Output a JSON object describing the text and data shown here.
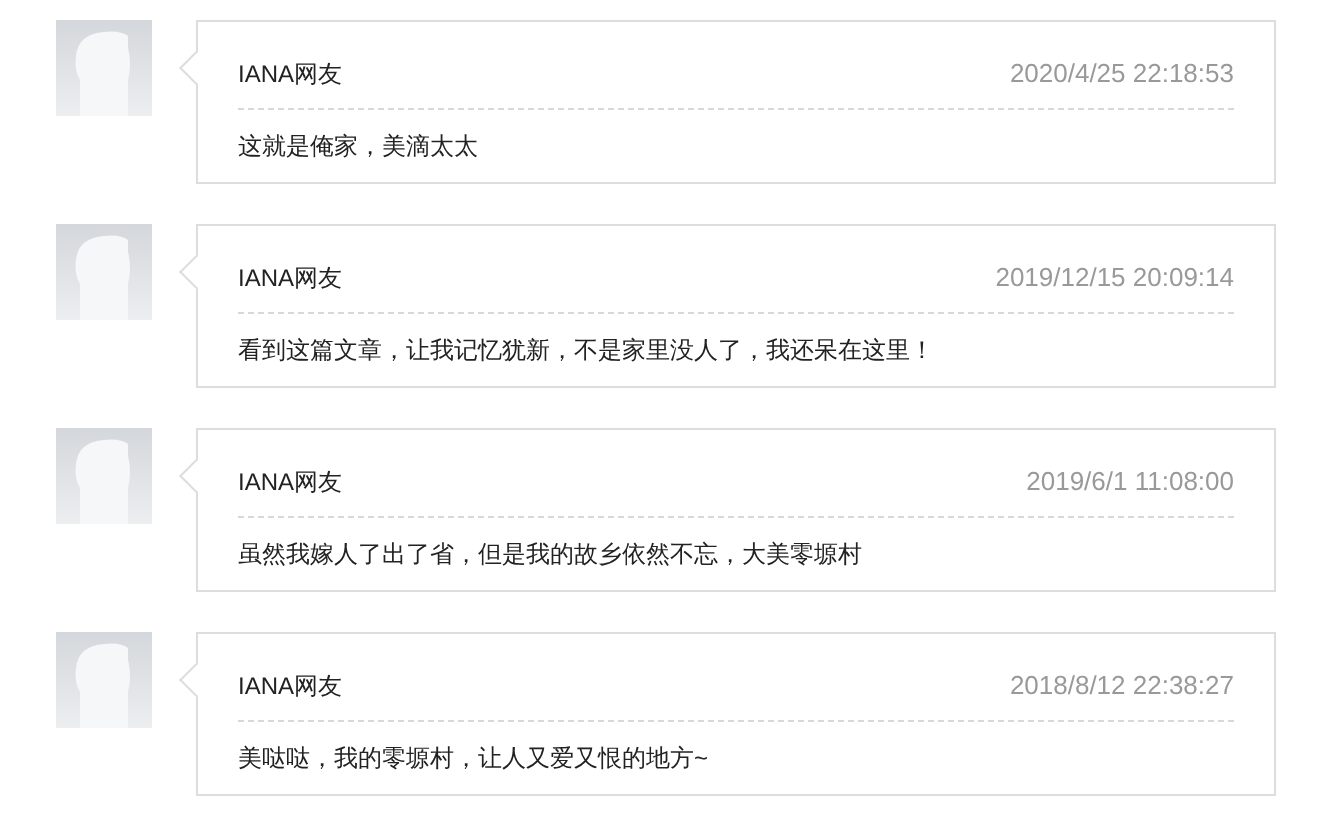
{
  "comments": [
    {
      "user": "IANA网友",
      "time": "2020/4/25 22:18:53",
      "text": "这就是俺家，美滴太太"
    },
    {
      "user": "IANA网友",
      "time": "2019/12/15 20:09:14",
      "text": "看到这篇文章，让我记忆犹新，不是家里没人了，我还呆在这里！"
    },
    {
      "user": "IANA网友",
      "time": "2019/6/1 11:08:00",
      "text": "虽然我嫁人了出了省，但是我的故乡依然不忘，大美零塬村"
    },
    {
      "user": "IANA网友",
      "time": "2018/8/12 22:38:27",
      "text": "美哒哒，我的零塬村，让人又爱又恨的地方~"
    }
  ]
}
